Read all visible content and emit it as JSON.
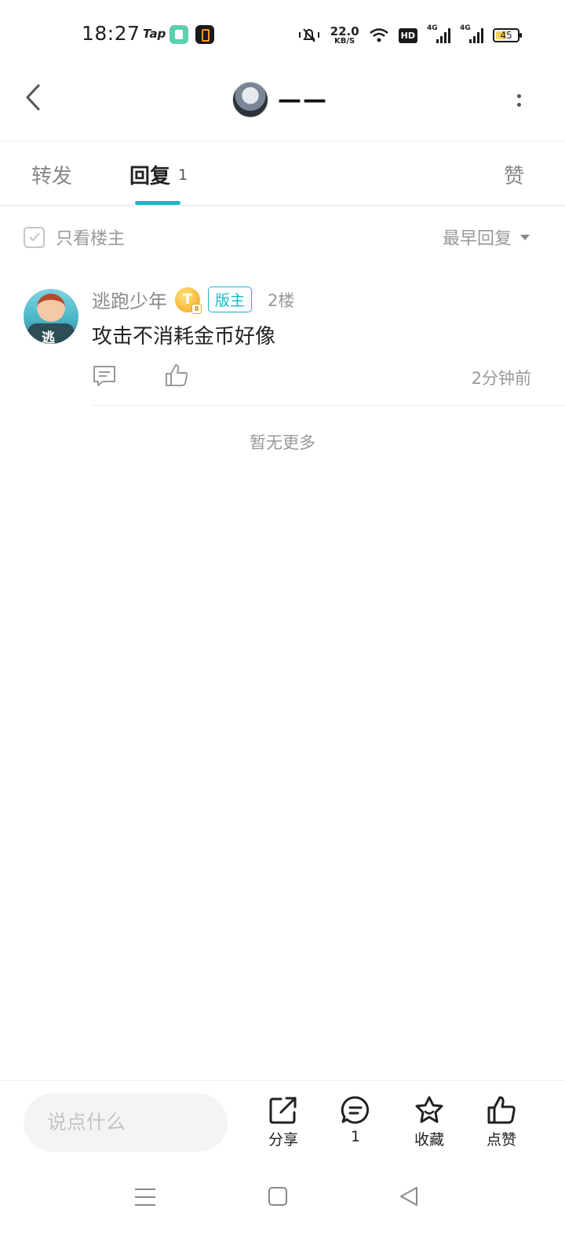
{
  "status_bar": {
    "time": "18:27",
    "tap_label": "Tap",
    "speed_value": "22.0",
    "speed_unit": "KB/S",
    "hd_label": "HD",
    "net_1": "4G",
    "net_2": "4G",
    "battery": "45"
  },
  "header": {
    "title": "——"
  },
  "tabs": {
    "forward": "转发",
    "reply": "回复",
    "reply_count": "1",
    "like": "赞"
  },
  "filter": {
    "only_op": "只看楼主",
    "sort": "最早回复"
  },
  "reply": {
    "username": "逃跑少年",
    "level_letter": "T",
    "level_num": "8",
    "role_badge": "版主",
    "floor": "2楼",
    "avatar_text": "逃",
    "content": "攻击不消耗金币好像",
    "time": "2分钟前"
  },
  "no_more": "暂无更多",
  "bottom_bar": {
    "input_placeholder": "说点什么",
    "share": "分享",
    "comments": "1",
    "favorite": "收藏",
    "like": "点赞"
  },
  "colors": {
    "accent": "#15b8c7",
    "secondary_text": "#999999"
  }
}
